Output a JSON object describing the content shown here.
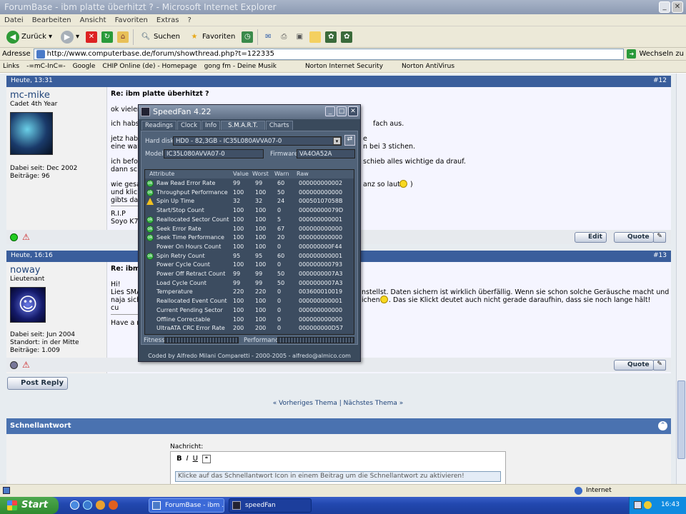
{
  "window": {
    "title": "ForumBase - ibm platte überhitzt ? - Microsoft Internet Explorer"
  },
  "menu": [
    "Datei",
    "Bearbeiten",
    "Ansicht",
    "Favoriten",
    "Extras",
    "?"
  ],
  "toolbar": {
    "back": "Zurück",
    "search": "Suchen",
    "favorites": "Favoriten"
  },
  "address": {
    "label": "Adresse",
    "url": "http://www.computerbase.de/forum/showthread.php?t=122335",
    "go": "Wechseln zu"
  },
  "links": {
    "label": "Links",
    "items": [
      "-=mC-InC=-",
      "Google",
      "CHIP Online (de) - Homepage",
      "gong fm - Deine Musik",
      "Norton Internet Security",
      "Norton AntiVirus"
    ]
  },
  "post1": {
    "date": "Heute, 13:31",
    "number": "#12",
    "user": "mc-mike",
    "rank": "Cadet 4th Year",
    "joined": "Dabei seit: Dec 2002",
    "posts": "Beiträge: 96",
    "title": "Re: ibm platte überhitzt ?",
    "lines": [
      "ok vieler",
      "ich habs",
      "jetz hab",
      "eine war",
      "ich befol",
      "dann sch",
      "wie gesa",
      "und klick",
      "gibts da",
      "R.I.P",
      "Soyo K7V"
    ],
    "right_lines": [
      {
        "text": "fach aus."
      },
      {
        "text": "e"
      },
      {
        "text": "n bei 3 stichen."
      },
      {
        "text": "schieb alles wichtige da drauf."
      },
      {
        "text": "anz so laut"
      },
      {
        "text": ")"
      }
    ],
    "edit": "Edit",
    "quote": "Quote"
  },
  "post2": {
    "date": "Heute, 16:16",
    "number": "#13",
    "user": "noway",
    "rank": "Lieutenant",
    "joined": "Dabei seit: Jun 2004",
    "location": "Standort: in der Mitte",
    "posts": "Beiträge: 1.009",
    "title": "Re: ibm",
    "lines": [
      "Hi!",
      "Lies SMA",
      "naja sich",
      "cu",
      "Have a n"
    ],
    "right_lines": [
      {
        "text": "nstellst. Daten sichern ist wirklich überfällig. Wenn sie schon solche Geräusche macht und"
      },
      {
        "text": "ichen"
      },
      {
        "text": ". Das sie Klickt deutet auch nicht gerade daraufhin, dass sie noch lange hält!"
      }
    ],
    "quote": "Quote"
  },
  "post_reply": "Post Reply",
  "thread_nav": {
    "prev": "Vorheriges Thema",
    "sep": "|",
    "next": "Nächstes Thema"
  },
  "quickreply": {
    "title": "Schnellantwort",
    "message_label": "Nachricht:",
    "placeholder": "Klicke auf das Schnellantwort Icon in einem Beitrag um die Schnellantwort zu aktivieren!"
  },
  "speedfan": {
    "title": "SpeedFan 4.22",
    "tabs": [
      "Readings",
      "Clock",
      "Info",
      "S.M.A.R.T.",
      "Charts"
    ],
    "harddisk_label": "Hard disk",
    "harddisk_value": "HD0 - 82,3GB - IC35L080AVVA07-0",
    "model_label": "Model",
    "model_value": "IC35L080AVVA07-0",
    "firmware_label": "Firmware",
    "firmware_value": "VA4OA52A",
    "columns": [
      "Attribute",
      "Value",
      "Worst",
      "Warn",
      "Raw"
    ],
    "rows": [
      {
        "icon": "ok",
        "attr": "Raw Read Error Rate",
        "value": "99",
        "worst": "99",
        "warn": "60",
        "raw": "000000000002"
      },
      {
        "icon": "ok",
        "attr": "Throughput Performance",
        "value": "100",
        "worst": "100",
        "warn": "50",
        "raw": "000000000000"
      },
      {
        "icon": "warn",
        "attr": "Spin Up Time",
        "value": "32",
        "worst": "32",
        "warn": "24",
        "raw": "00050107058B"
      },
      {
        "icon": "",
        "attr": "Start/Stop Count",
        "value": "100",
        "worst": "100",
        "warn": "0",
        "raw": "00000000079D"
      },
      {
        "icon": "ok",
        "attr": "Reallocated Sector Count",
        "value": "100",
        "worst": "100",
        "warn": "5",
        "raw": "000000000001"
      },
      {
        "icon": "ok",
        "attr": "Seek Error Rate",
        "value": "100",
        "worst": "100",
        "warn": "67",
        "raw": "000000000000"
      },
      {
        "icon": "ok",
        "attr": "Seek Time Performance",
        "value": "100",
        "worst": "100",
        "warn": "20",
        "raw": "000000000000"
      },
      {
        "icon": "",
        "attr": "Power On Hours Count",
        "value": "100",
        "worst": "100",
        "warn": "0",
        "raw": "000000000F44"
      },
      {
        "icon": "ok",
        "attr": "Spin Retry Count",
        "value": "95",
        "worst": "95",
        "warn": "60",
        "raw": "000000000001"
      },
      {
        "icon": "",
        "attr": "Power Cycle Count",
        "value": "100",
        "worst": "100",
        "warn": "0",
        "raw": "000000000793"
      },
      {
        "icon": "",
        "attr": "Power Off Retract Count",
        "value": "99",
        "worst": "99",
        "warn": "50",
        "raw": "0000000007A3"
      },
      {
        "icon": "",
        "attr": "Load Cycle Count",
        "value": "99",
        "worst": "99",
        "warn": "50",
        "raw": "0000000007A3"
      },
      {
        "icon": "",
        "attr": "Temperature",
        "value": "220",
        "worst": "220",
        "warn": "0",
        "raw": "003600010019"
      },
      {
        "icon": "",
        "attr": "Reallocated Event Count",
        "value": "100",
        "worst": "100",
        "warn": "0",
        "raw": "000000000001"
      },
      {
        "icon": "",
        "attr": "Current Pending Sector",
        "value": "100",
        "worst": "100",
        "warn": "0",
        "raw": "000000000000"
      },
      {
        "icon": "",
        "attr": "Offline Correctable",
        "value": "100",
        "worst": "100",
        "warn": "0",
        "raw": "000000000000"
      },
      {
        "icon": "",
        "attr": "UltraATA CRC Error Rate",
        "value": "200",
        "worst": "200",
        "warn": "0",
        "raw": "000000000D57"
      }
    ],
    "fitness_label": "Fitness",
    "performance_label": "Performance",
    "footer": "Coded by Alfredo Milani Comparetti - 2000-2005 - alfredo@almico.com"
  },
  "status": {
    "zone": "Internet"
  },
  "taskbar": {
    "start": "Start",
    "tasks": [
      "ForumBase - ibm ...",
      "speedFan"
    ],
    "clock": "16:43"
  }
}
